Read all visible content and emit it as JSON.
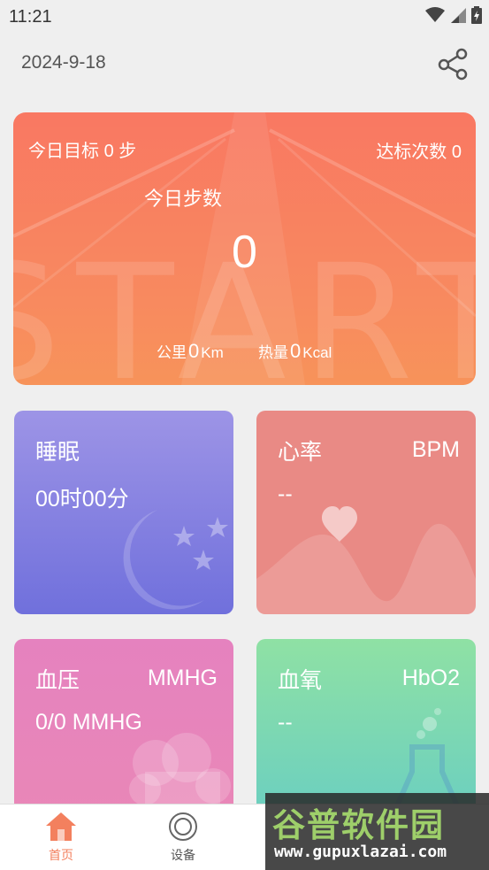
{
  "status_bar": {
    "time": "11:21"
  },
  "header": {
    "date": "2024-9-18"
  },
  "steps_card": {
    "goal_label": "今日目标",
    "goal_value": "0",
    "goal_unit": "步",
    "reach_label": "达标次数",
    "reach_value": "0",
    "today_label": "今日步数",
    "steps": "0",
    "distance_label": "公里",
    "distance_value": "0",
    "distance_unit": "Km",
    "calorie_label": "热量",
    "calorie_value": "0",
    "calorie_unit": "Kcal",
    "background_text": "START"
  },
  "sleep": {
    "title": "睡眠",
    "value": "00时00分"
  },
  "heart": {
    "title": "心率",
    "unit": "BPM",
    "value": "--"
  },
  "blood_pressure": {
    "title": "血压",
    "unit": "MMHG",
    "value": "0/0 MMHG"
  },
  "oxygen": {
    "title": "血氧",
    "unit": "HbO2",
    "value": "--"
  },
  "nav": {
    "home_label": "首页",
    "device_label": "设备"
  },
  "watermark": {
    "title": "谷普软件园",
    "url": "www.gupuxlazai.com"
  },
  "colors": {
    "accent": "#f3805e",
    "steps_card": "#f97862",
    "sleep": "#7e7ce0",
    "heart": "#e98a85",
    "blood_pressure": "#e785bb",
    "oxygen": "#7ed8b3"
  }
}
